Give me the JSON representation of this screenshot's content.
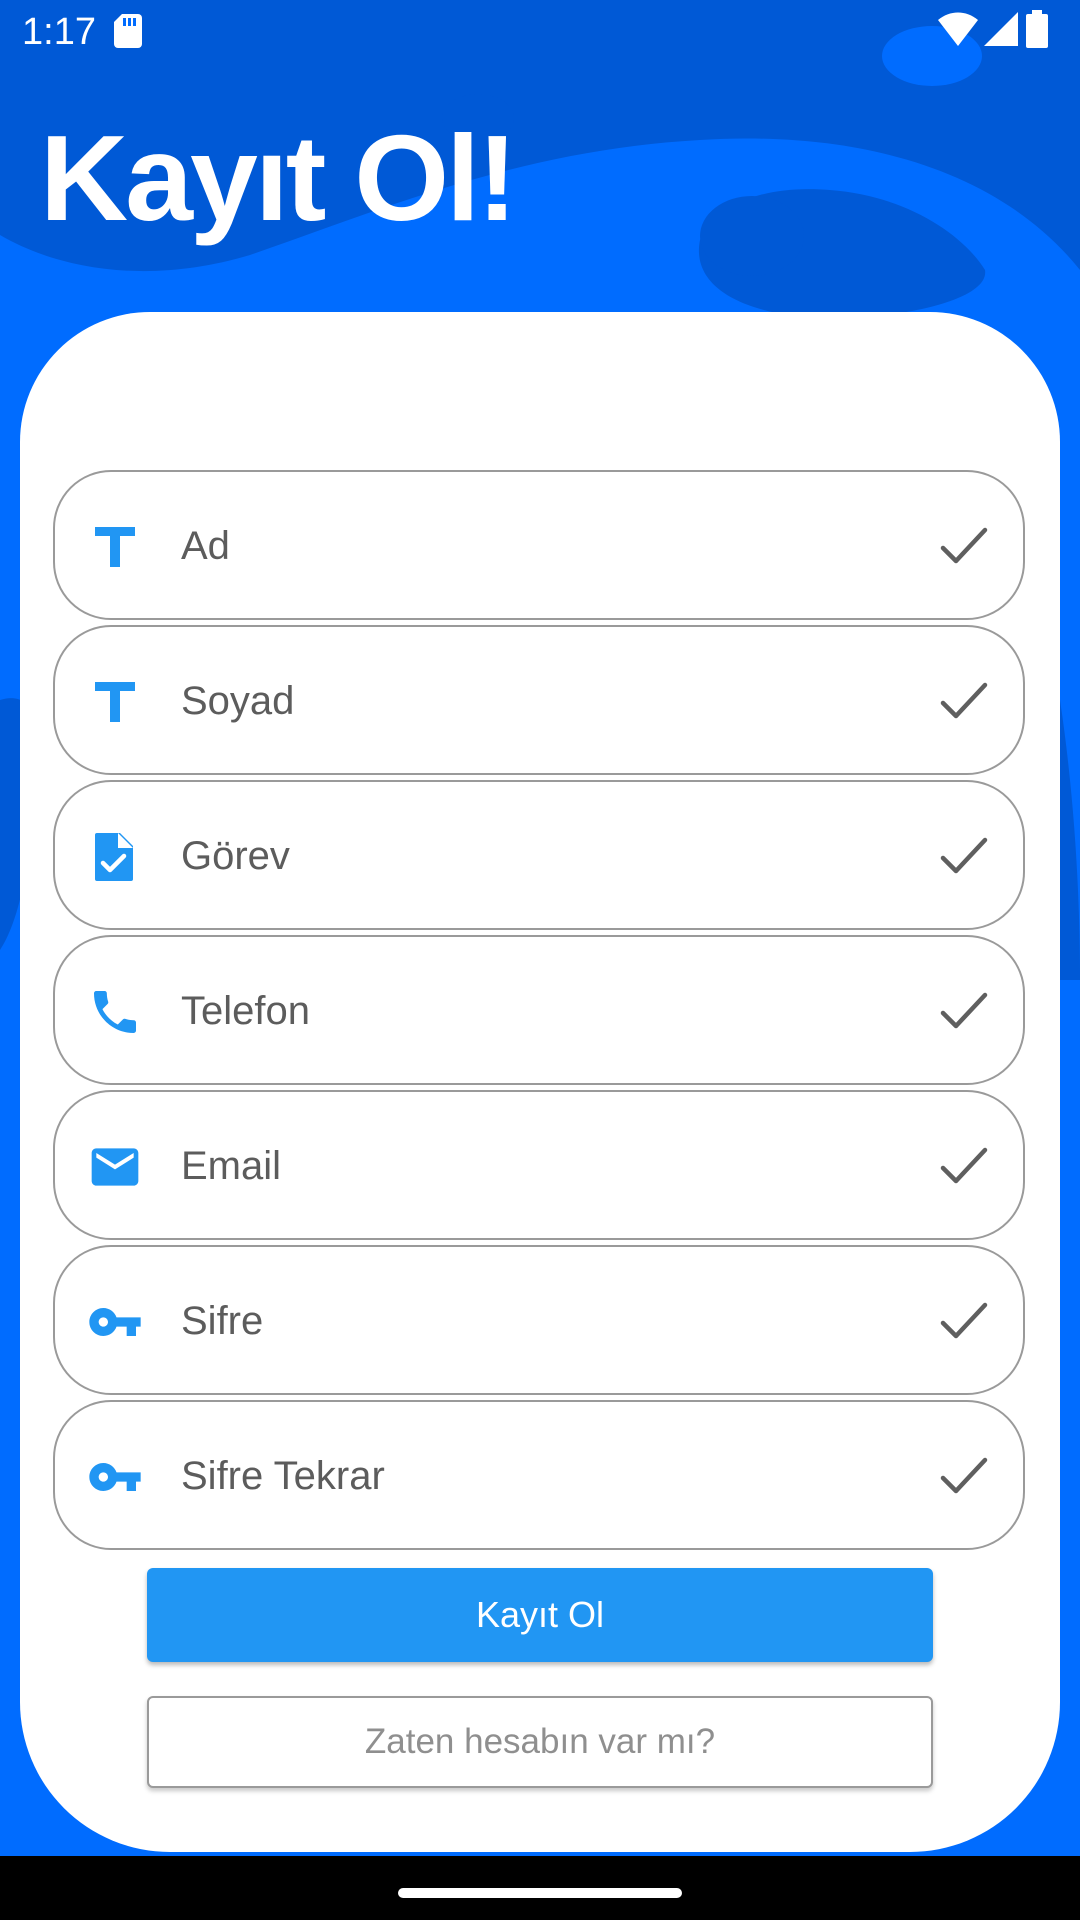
{
  "status_bar": {
    "time": "1:17",
    "icons": [
      "sd-card-icon",
      "wifi-icon",
      "signal-icon",
      "battery-icon"
    ]
  },
  "page": {
    "title": "Kayıt Ol!"
  },
  "form": {
    "fields": [
      {
        "label": "Ad",
        "icon": "text-icon"
      },
      {
        "label": "Soyad",
        "icon": "text-icon"
      },
      {
        "label": "Görev",
        "icon": "task-document-icon"
      },
      {
        "label": "Telefon",
        "icon": "phone-icon"
      },
      {
        "label": "Email",
        "icon": "email-icon"
      },
      {
        "label": "Sifre",
        "icon": "key-icon"
      },
      {
        "label": "Sifre Tekrar",
        "icon": "key-icon"
      }
    ],
    "submit_label": "Kayıt Ol",
    "login_link_label": "Zaten hesabın var mı?"
  },
  "colors": {
    "background": "#006cff",
    "background_dark": "#0059d6",
    "accent": "#2196f3",
    "card": "#ffffff",
    "field_border": "#9a9a9a",
    "label_text": "#5c5c5c"
  }
}
